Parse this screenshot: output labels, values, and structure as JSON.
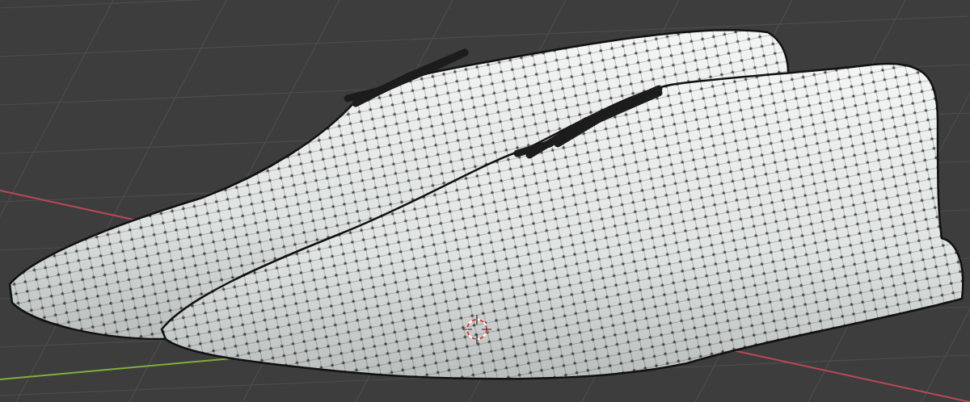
{
  "viewport": {
    "grid": true,
    "x_axis": true,
    "y_axis": true,
    "objects": [
      {
        "kind": "shoe"
      },
      {
        "kind": "shoe"
      }
    ],
    "cursor": true
  }
}
